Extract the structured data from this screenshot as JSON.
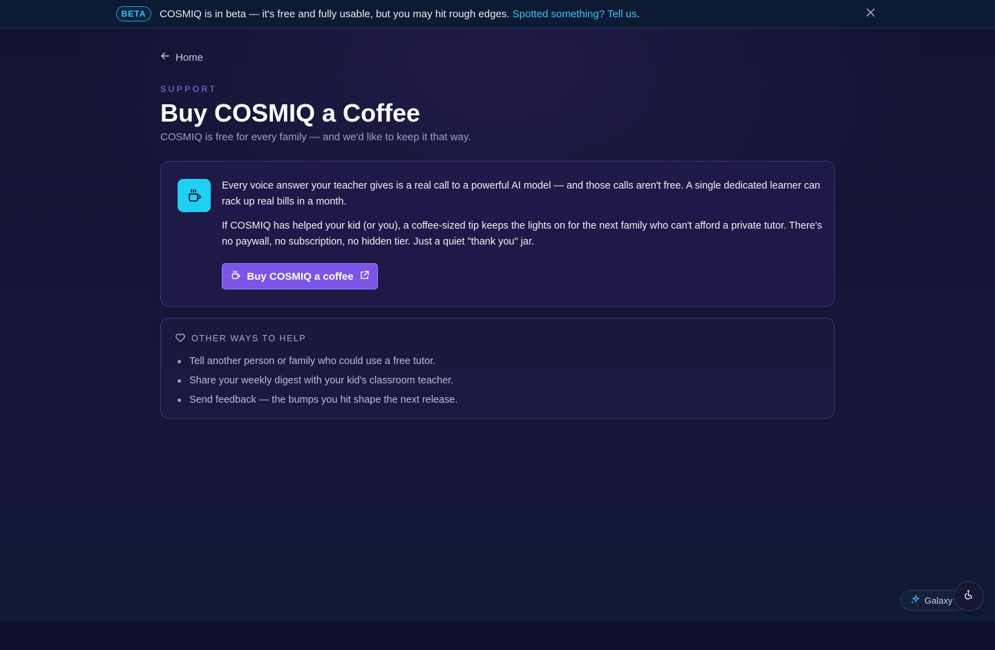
{
  "banner": {
    "badge": "BETA",
    "message": "COSMIQ is in beta — it's free and fully usable, but you may hit rough edges.",
    "link": "Spotted something? Tell us",
    "link_suffix": ".",
    "close_icon": "close-icon"
  },
  "nav": {
    "back_label": "Home",
    "back_icon": "arrow-left-icon"
  },
  "header": {
    "eyebrow": "SUPPORT",
    "title": "Buy COSMIQ a Coffee",
    "subtitle": "COSMIQ is free for every family — and we'd like to keep it that way."
  },
  "main_card": {
    "icon": "coffee-icon",
    "paragraph_1": "Every voice answer your teacher gives is a real call to a powerful AI model — and those calls aren't free. A single dedicated learner can rack up real bills in a month.",
    "paragraph_2": "If COSMIQ has helped your kid (or you), a coffee-sized tip keeps the lights on for the next family who can't afford a private tutor. There's no paywall, no subscription, no hidden tier. Just a quiet \"thank you\" jar.",
    "button_label": "Buy COSMIQ a coffee"
  },
  "help_card": {
    "icon": "heart-icon",
    "title": "OTHER WAYS TO HELP",
    "items": [
      "Tell another person or family who could use a free tutor.",
      "Share your weekly digest with your kid's classroom teacher.",
      "Send feedback — the bumps you hit shape the next release."
    ]
  },
  "widgets": {
    "galaxy_label": "Galaxy",
    "galaxy_icon": "sparkle-icon",
    "a11y_icon": "accessibility-icon"
  },
  "colors": {
    "accent": "#7a55e8",
    "cyan": "#1fd0f2",
    "background": "#111332"
  }
}
